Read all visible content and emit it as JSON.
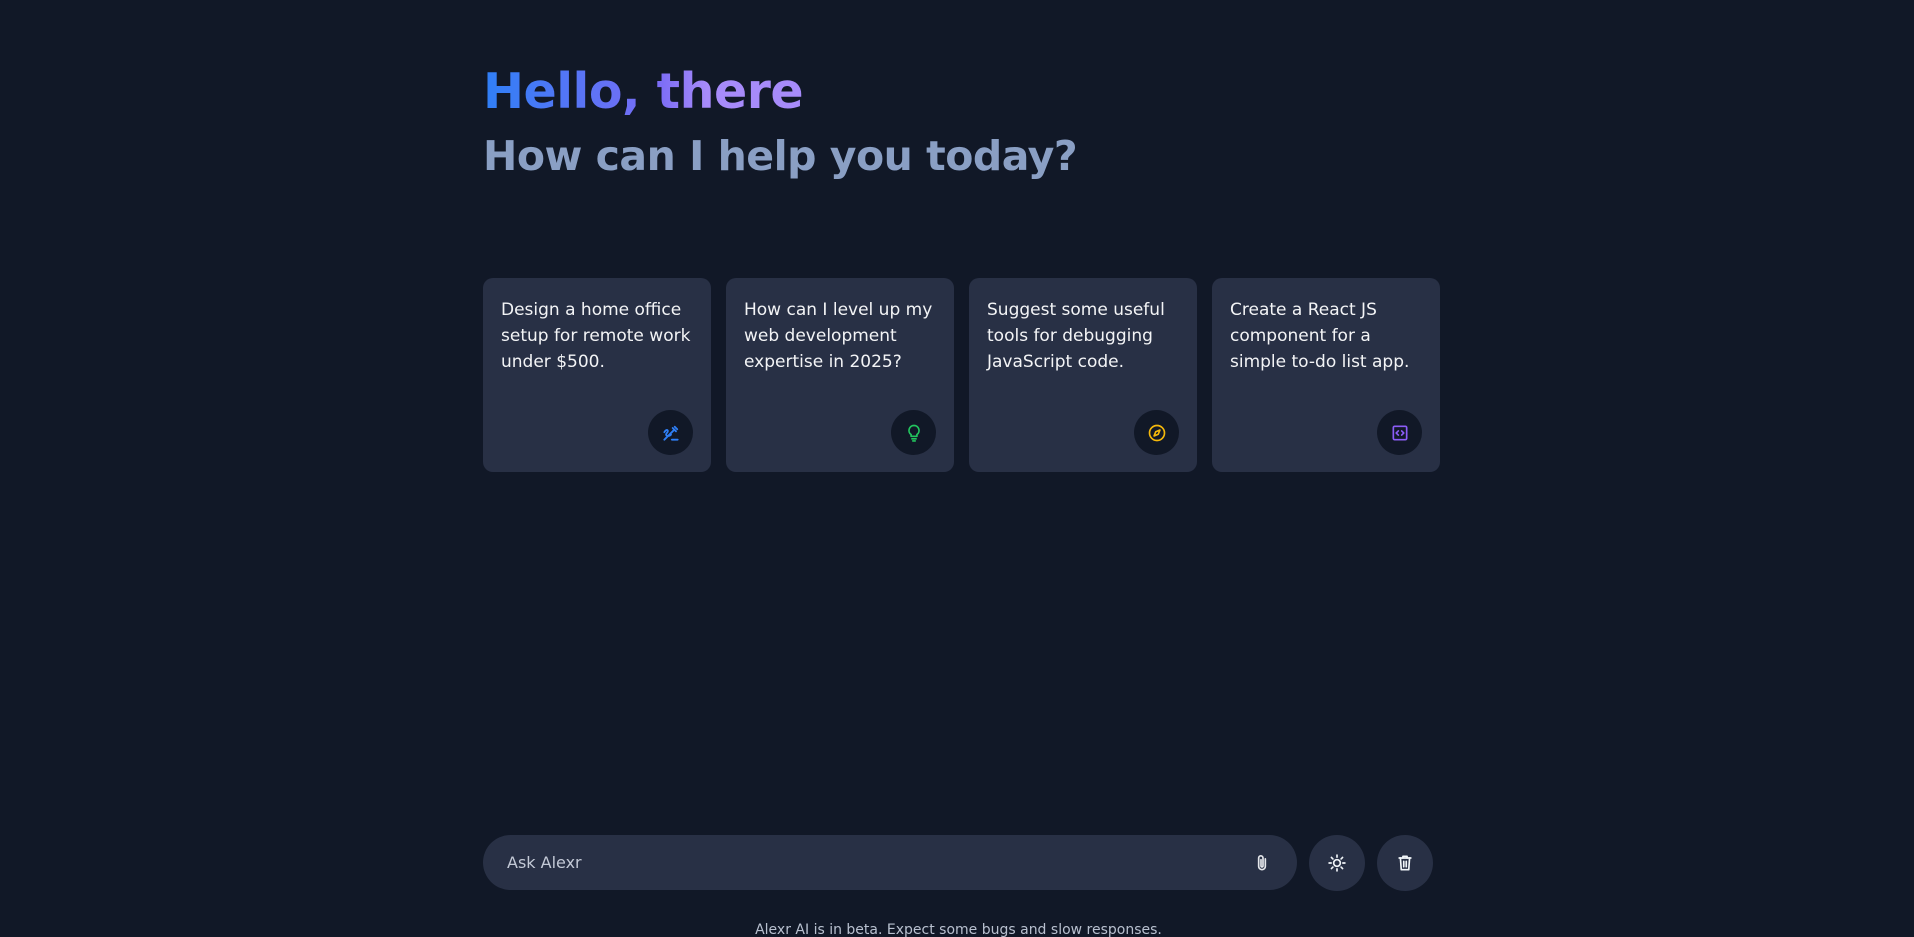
{
  "header": {
    "greeting": "Hello, there",
    "subheading": "How can I help you today?"
  },
  "suggestions": [
    {
      "text": "Design a home office setup for remote work under $500.",
      "icon": "draw-icon",
      "icon_color": "#2f7ff6"
    },
    {
      "text": "How can I level up my web development expertise in 2025?",
      "icon": "lightbulb-icon",
      "icon_color": "#22c55e"
    },
    {
      "text": "Suggest some useful tools for debugging JavaScript code.",
      "icon": "explore-icon",
      "icon_color": "#f5b80b"
    },
    {
      "text": "Create a React JS component for a simple to-do list app.",
      "icon": "code-blocks-icon",
      "icon_color": "#8b5cf6"
    }
  ],
  "prompt": {
    "placeholder": "Ask Alexr",
    "value": ""
  },
  "buttons": {
    "attach_icon": "attach-file-icon",
    "theme_icon": "light-mode-icon",
    "delete_icon": "delete-icon"
  },
  "footer": {
    "disclaimer": "Alexr AI is in beta. Expect some bugs and slow responses."
  },
  "colors": {
    "background": "#111827",
    "surface": "#283045",
    "accent_gradient_start": "#2f7ff6",
    "accent_gradient_end": "#a78bfa",
    "subheading": "#8a9fc4"
  }
}
